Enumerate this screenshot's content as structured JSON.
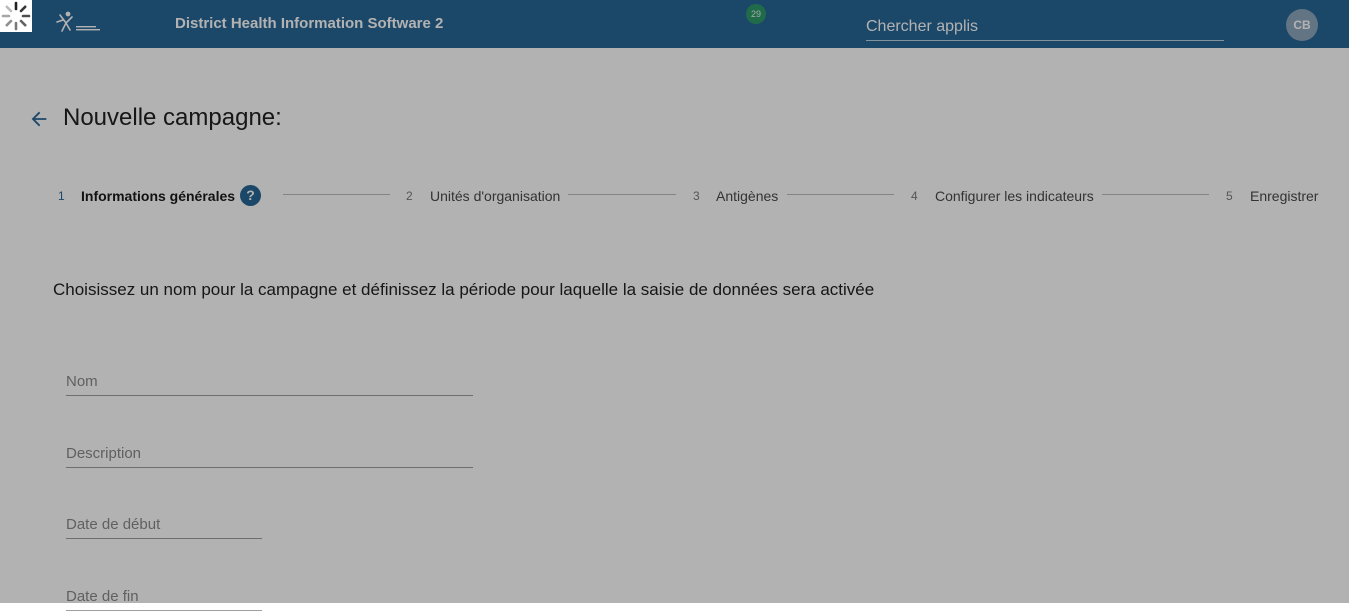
{
  "header": {
    "app_title": "District Health Information Software 2",
    "notification_count": "29",
    "search_placeholder": "Chercher applis",
    "user_initials": "CB",
    "color": "#276696"
  },
  "page": {
    "title": "Nouvelle campagne:"
  },
  "stepper": {
    "steps": [
      {
        "number": "1",
        "label": "Informations générales",
        "active": true
      },
      {
        "number": "2",
        "label": "Unités d'organisation",
        "active": false
      },
      {
        "number": "3",
        "label": "Antigènes",
        "active": false
      },
      {
        "number": "4",
        "label": "Configurer les indicateurs",
        "active": false
      },
      {
        "number": "5",
        "label": "Enregistrer",
        "active": false
      }
    ],
    "help_symbol": "?"
  },
  "form": {
    "instructions": "Choisissez un nom pour la campagne et définissez la période pour laquelle la saisie de données sera activée",
    "fields": {
      "name_placeholder": "Nom",
      "description_placeholder": "Description",
      "start_date_placeholder": "Date de début",
      "end_date_placeholder": "Date de fin"
    }
  },
  "icons": {
    "back": "arrow-back-icon",
    "help": "help-icon",
    "spinner": "loading-spinner-icon",
    "logo": "msf-logo"
  }
}
